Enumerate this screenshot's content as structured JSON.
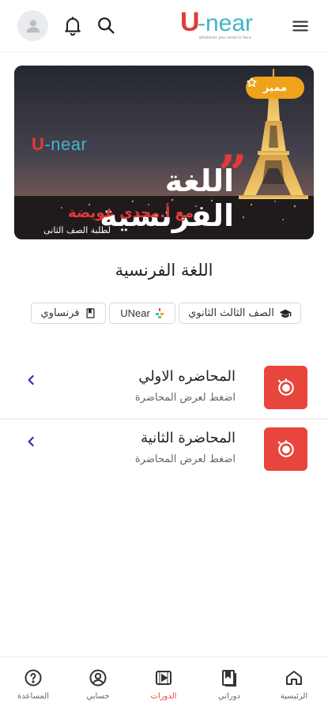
{
  "header": {
    "logo_u": "U",
    "logo_text": "-near",
    "logo_tagline": "whatever you need is here"
  },
  "banner": {
    "badge": "مميز",
    "logo_u": "U",
    "logo_text": "-near",
    "title": "اللغة الفرنسية",
    "teacher": "مع أ.مجدى عويضة",
    "grade": "لطلبة الصف الثانى"
  },
  "course": {
    "title": "اللغة الفرنسية",
    "tags": {
      "grade": "الصف الثالث الثانوي",
      "provider": "UNear",
      "language": "فرنساوي"
    }
  },
  "lectures": [
    {
      "title": "المحاضره الاولي",
      "subtitle": "اضغط لعرض المحاضرة"
    },
    {
      "title": "المحاضرة الثانية",
      "subtitle": "اضغط لعرض المحاضرة"
    }
  ],
  "bottom_nav": {
    "home": "الرئيسية",
    "my_courses": "دوراتي",
    "courses": "الدورات",
    "account": "حسابي",
    "help": "المساعدة"
  },
  "colors": {
    "accent_red": "#e8453c",
    "badge_orange": "#f0a31a",
    "logo_teal": "#42b5c8"
  }
}
